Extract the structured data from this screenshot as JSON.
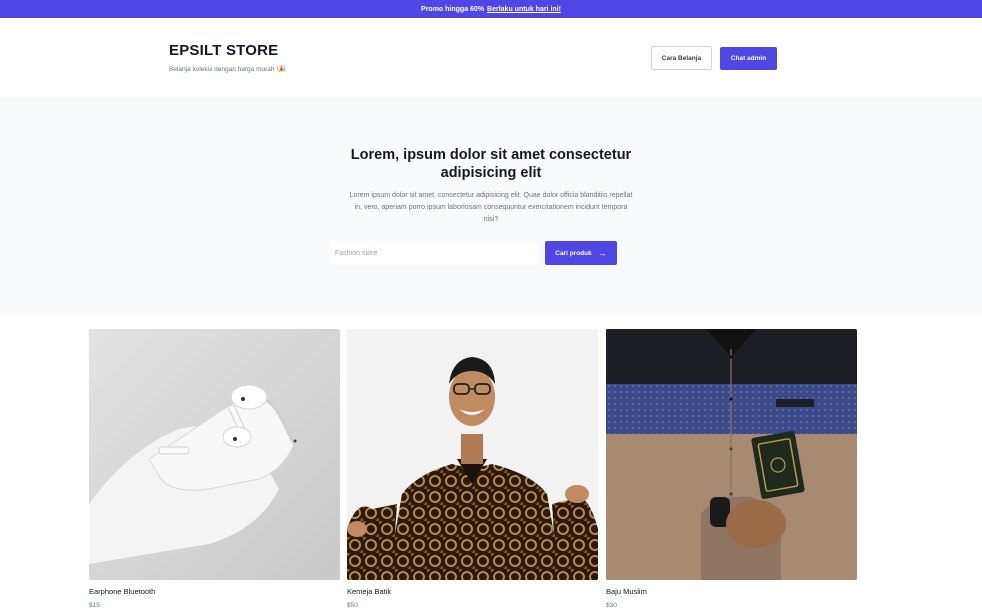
{
  "promo": {
    "text": "Promo hingga 60%",
    "link": "Berlaku untuk hari ini!"
  },
  "header": {
    "brand": "EPSILT STORE",
    "tagline": "Belanja koleksi dengan harga murah !🎉",
    "guide_button": "Cara Belanja",
    "chat_button": "Chat admin"
  },
  "hero": {
    "title": "Lorem, ipsum dolor sit amet consectetur adipisicing elit",
    "description": "Lorem ipsum dolor sit amet, consectetur adipisicing elit. Quae dolor officia blanditiis repellat in, vero, aperiam porro ipsum laboriosam consequuntur exercitationem incidunt tempora nisi?",
    "search_placeholder": "Fashion store",
    "search_button": "Cari produk"
  },
  "products": [
    {
      "name": "Earphone Bluetooth",
      "price": "$15"
    },
    {
      "name": "Kemeja Batik",
      "price": "$50"
    },
    {
      "name": "Baju Muslim",
      "price": "$30"
    }
  ],
  "colors": {
    "accent": "#4f46e5",
    "hero_background": "#f9fafb"
  }
}
